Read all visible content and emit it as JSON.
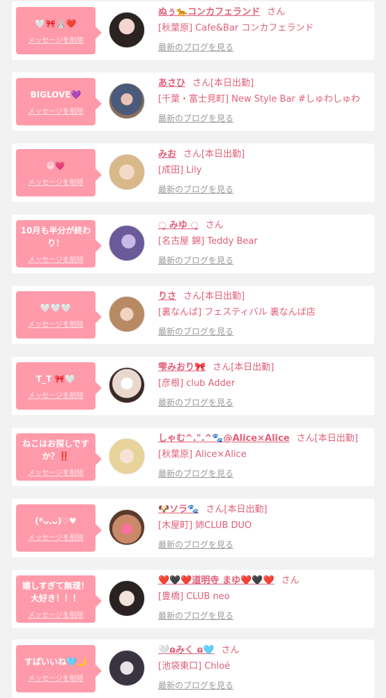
{
  "items": [
    {
      "msg": "🤍🎀🐰❤️",
      "delete": "メッセージを削除",
      "name": "ぬぅ🐆コンカフェランド",
      "suffix": "さん",
      "status": "",
      "shop": "[秋葉原] Cafe&Bar コンカフェランド",
      "blog": "最新のブログを見る"
    },
    {
      "msg": "BIGLOVE💜",
      "delete": "メッセージを削除",
      "name": "あさひ",
      "suffix": "さん",
      "status": "[本日出勤]",
      "shop": "[千葉・富士見町] New Style Bar #しゅわしゅわ",
      "blog": "最新のブログを見る"
    },
    {
      "msg": "😁💗",
      "delete": "メッセージを削除",
      "name": "みお",
      "suffix": "さん",
      "status": "[本日出勤]",
      "shop": "[成田] Lily",
      "blog": "最新のブログを見る"
    },
    {
      "msg": "10月も半分が終わり！",
      "delete": "メッセージを削除",
      "name": "◌̥ みゆ ◌̥",
      "suffix": "さん",
      "status": "",
      "shop": "[名古屋 錦] Teddy Bear",
      "blog": "最新のブログを見る"
    },
    {
      "msg": "🤍🤍🤍",
      "delete": "メッセージを削除",
      "name": "りさ",
      "suffix": "さん",
      "status": "[本日出勤]",
      "shop": "[裏なんば] フェスティバル 裏なんば店",
      "blog": "最新のブログを見る"
    },
    {
      "msg": "T_T 🎀🤍",
      "delete": "メッセージを削除",
      "name": "雫みおり🎀",
      "suffix": "さん",
      "status": "[本日出勤]",
      "shop": "[彦根] club Adder",
      "blog": "最新のブログを見る"
    },
    {
      "msg": "ねこはお探しですか？‼️",
      "delete": "メッセージを削除",
      "name": "しゃむ^.\".^🐾@Alice×Alice",
      "suffix": "さん",
      "status": "[本日出勤]",
      "shop": "[秋葉原] Alice×Alice",
      "blog": "最新のブログを見る"
    },
    {
      "msg": "(*ᴗ.ᴗ)♡♥",
      "delete": "メッセージを削除",
      "name": "🐶ソラ🐾",
      "suffix": "さん",
      "status": "[本日出勤]",
      "shop": "[木屋町] 姉CLUB DUO",
      "blog": "最新のブログを見る"
    },
    {
      "msg": "嬉しすぎて無理！大好き！！！",
      "delete": "メッセージを削除",
      "name": "❤️🖤❤️道明寺 まゆ❤️🖤❤️",
      "suffix": "さん",
      "status": "",
      "shop": "[豊橋] CLUB neo",
      "blog": "最新のブログを見る"
    },
    {
      "msg": "すばいいね🩵🌙",
      "delete": "メッセージを削除",
      "name": "🤍ɷみく ɷ🩵",
      "suffix": "さん",
      "status": "",
      "shop": "[池袋東口] Chloé",
      "blog": "最新のブログを見る"
    }
  ]
}
